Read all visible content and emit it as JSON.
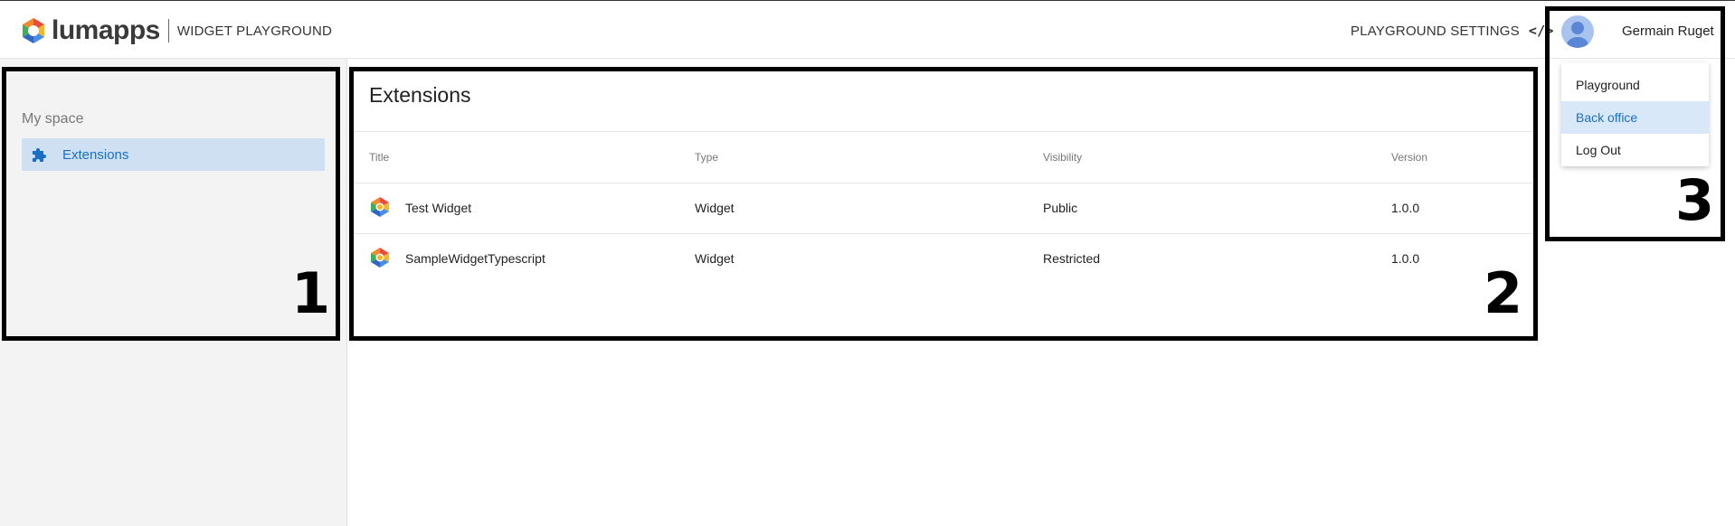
{
  "header": {
    "logo_text": "lumapps",
    "app_title": "WIDGET PLAYGROUND",
    "settings_label": "PLAYGROUND SETTINGS",
    "settings_icon": "code-icon",
    "user_name": "Germain Ruget"
  },
  "user_menu": {
    "items": [
      {
        "label": "Playground",
        "active": false
      },
      {
        "label": "Back office",
        "active": true
      },
      {
        "label": "Log Out",
        "active": false
      }
    ]
  },
  "sidebar": {
    "heading": "My space",
    "items": [
      {
        "label": "Extensions",
        "icon": "puzzle-icon",
        "selected": true
      }
    ]
  },
  "main": {
    "title": "Extensions",
    "columns": [
      "Title",
      "Type",
      "Visibility",
      "Version"
    ],
    "rows": [
      {
        "title": "Test Widget",
        "type": "Widget",
        "visibility": "Public",
        "version": "1.0.0"
      },
      {
        "title": "SampleWidgetTypescript",
        "type": "Widget",
        "visibility": "Restricted",
        "version": "1.0.0"
      }
    ]
  },
  "annotations": [
    "1",
    "2",
    "3"
  ],
  "colors": {
    "accent": "#1a6fc4",
    "selected_bg": "#cfe0f3",
    "sidebar_bg": "#f3f3f3"
  }
}
